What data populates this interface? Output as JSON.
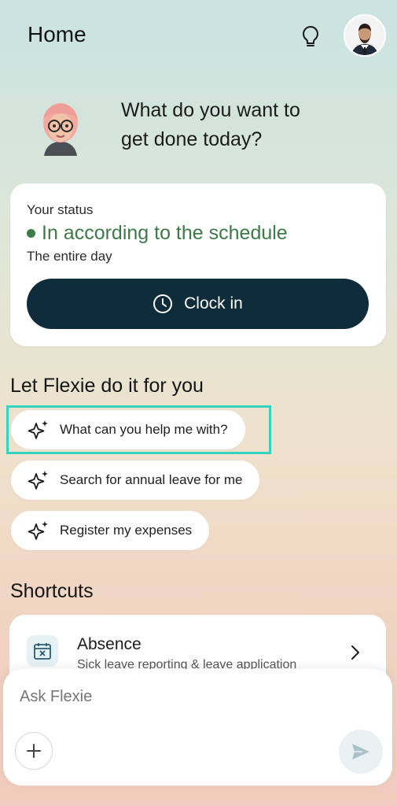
{
  "header": {
    "title": "Home",
    "bulb_icon": "lightbulb-icon",
    "avatar_icon": "user-avatar"
  },
  "greeting": {
    "line1": "What do you want to",
    "line2": "get done today?"
  },
  "status": {
    "label": "Your status",
    "value": "In according to the schedule",
    "sub": "The entire day",
    "status_color": "#3d7a47",
    "clock_button": "Clock in"
  },
  "flexie": {
    "heading": "Let Flexie do it for you",
    "suggestions": [
      "What can you help me with?",
      "Search for annual leave for me",
      "Register my expenses"
    ],
    "highlight_color": "#37d3c1"
  },
  "shortcuts": {
    "heading": "Shortcuts",
    "items": [
      {
        "title": "Absence",
        "subtitle": "Sick leave reporting & leave application",
        "icon": "calendar-x-icon"
      }
    ]
  },
  "ask": {
    "placeholder": "Ask Flexie",
    "plus_icon": "plus-icon",
    "send_icon": "send-icon"
  },
  "colors": {
    "primary_dark": "#0f2c3b",
    "accent_green": "#3d7a47"
  }
}
